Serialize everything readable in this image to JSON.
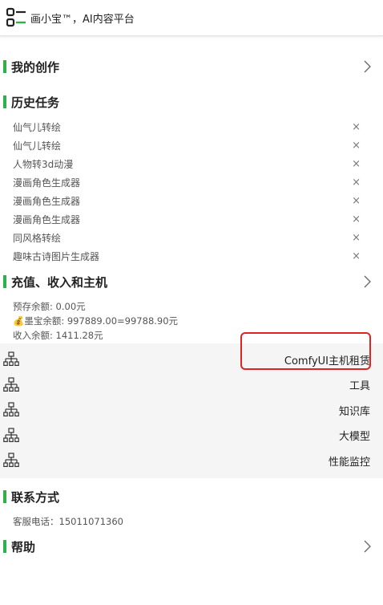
{
  "header": {
    "brand": "画小宝™，AI内容平台"
  },
  "sections": {
    "my_creations": "我的创作",
    "history": "历史任务",
    "recharge": "充值、收入和主机",
    "contact": "联系方式",
    "help": "帮助"
  },
  "history_items": [
    "仙气儿转绘",
    "仙气儿转绘",
    "人物转3d动漫",
    "漫画角色生成器",
    "漫画角色生成器",
    "漫画角色生成器",
    "同风格转绘",
    "趣味古诗图片生成器"
  ],
  "close_glyph": "×",
  "account": {
    "prepaid": "预存余额: 0.00元",
    "mobao": "💰墨宝余额: 997889.00=99788.90元",
    "income": "收入余额: 1411.28元"
  },
  "tools": [
    "ComfyUI主机租赁",
    "工具",
    "知识库",
    "大模型",
    "性能监控"
  ],
  "contact": {
    "phone": "客服电话：15011071360"
  },
  "colors": {
    "accent_bar": "#2fb14a",
    "highlight_border": "#e02424",
    "tools_bg": "#f5f5f5"
  },
  "icons": {
    "logo": "logo-icon",
    "chevron": "chevron-right-icon",
    "tool": "tree-structure-icon"
  }
}
